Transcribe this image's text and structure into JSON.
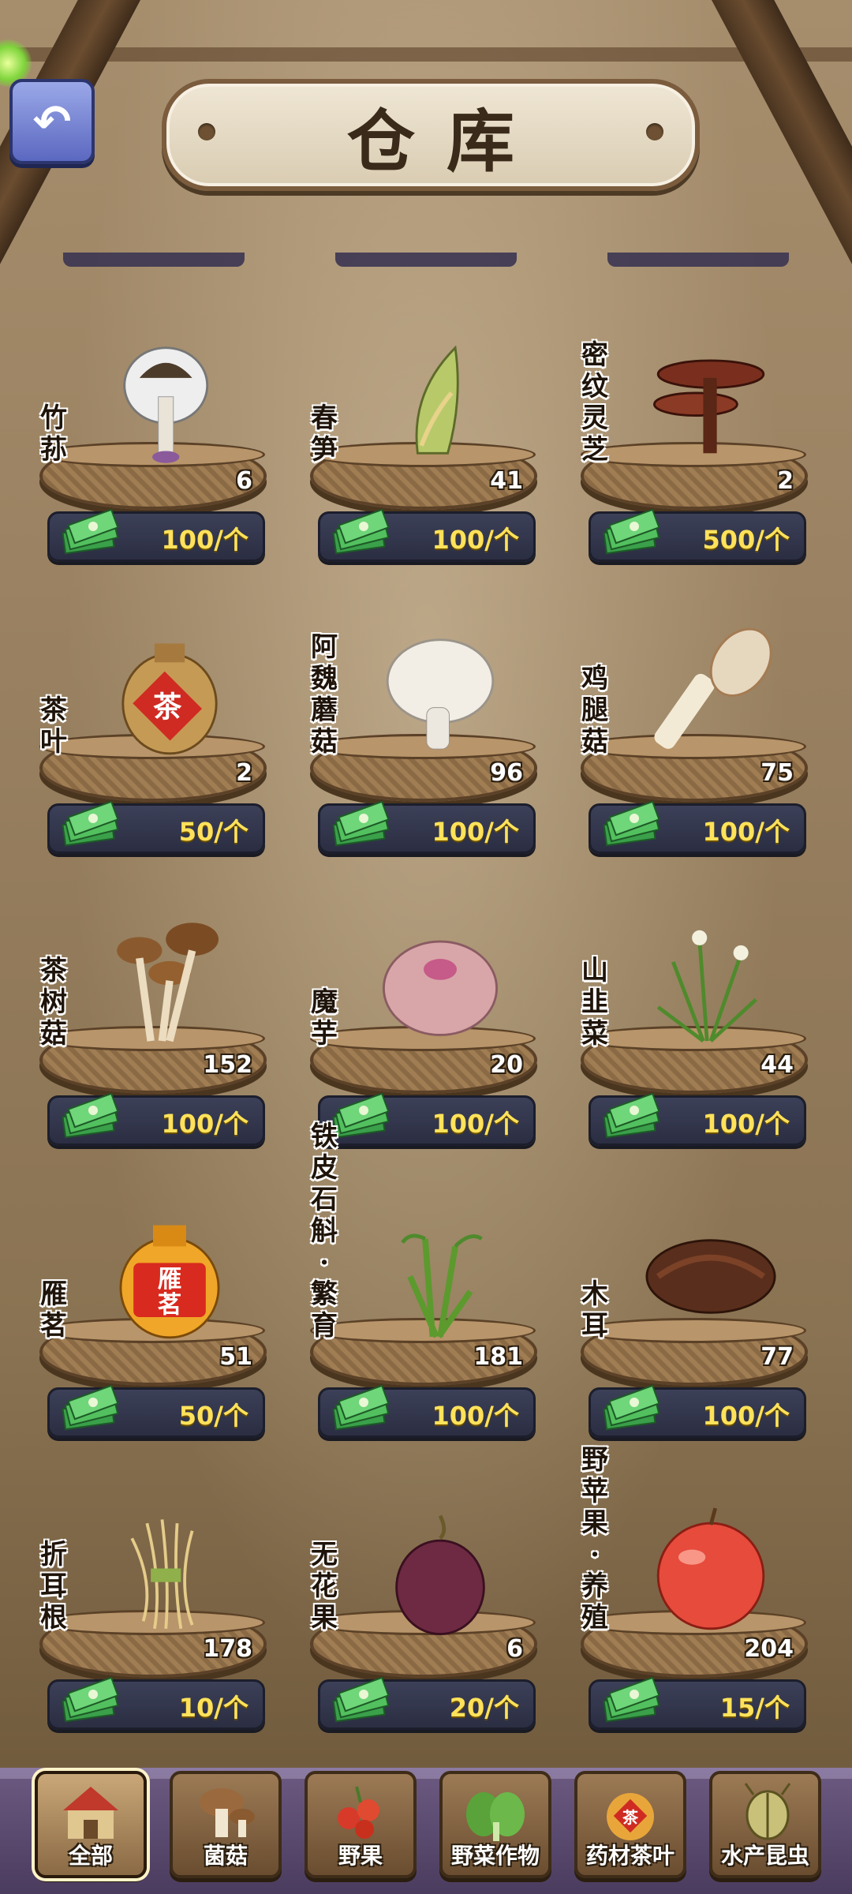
{
  "header": {
    "title": "仓库"
  },
  "colors": {
    "price_text": "#ffe25a",
    "tab_bar": "#4a3c5e",
    "back_button": "#5b68c0"
  },
  "items": [
    {
      "name": "竹荪",
      "count": "6",
      "price": "100/个",
      "icon": "bamboo-fungus-icon"
    },
    {
      "name": "春笋",
      "count": "41",
      "price": "100/个",
      "icon": "bamboo-shoot-icon"
    },
    {
      "name": "密纹灵芝",
      "count": "2",
      "price": "500/个",
      "icon": "lingzhi-icon"
    },
    {
      "name": "茶叶",
      "count": "2",
      "price": "50/个",
      "icon": "tea-jar-icon"
    },
    {
      "name": "阿魏蘑菇",
      "count": "96",
      "price": "100/个",
      "icon": "white-mushroom-icon"
    },
    {
      "name": "鸡腿菇",
      "count": "75",
      "price": "100/个",
      "icon": "shaggy-mane-icon"
    },
    {
      "name": "茶树菇",
      "count": "152",
      "price": "100/个",
      "icon": "tea-tree-mushroom-icon"
    },
    {
      "name": "魔芋",
      "count": "20",
      "price": "100/个",
      "icon": "konjac-icon"
    },
    {
      "name": "山韭菜",
      "count": "44",
      "price": "100/个",
      "icon": "wild-chive-icon"
    },
    {
      "name": "雁茗",
      "count": "51",
      "price": "50/个",
      "icon": "yanming-tea-jar-icon"
    },
    {
      "name": "铁皮石斛·繁育",
      "count": "181",
      "price": "100/个",
      "icon": "dendrobium-icon"
    },
    {
      "name": "木耳",
      "count": "77",
      "price": "100/个",
      "icon": "wood-ear-icon"
    },
    {
      "name": "折耳根",
      "count": "178",
      "price": "10/个",
      "icon": "houttuynia-root-icon"
    },
    {
      "name": "无花果",
      "count": "6",
      "price": "20/个",
      "icon": "fig-icon"
    },
    {
      "name": "野苹果·养殖",
      "count": "204",
      "price": "15/个",
      "icon": "apple-icon"
    }
  ],
  "tabs": [
    {
      "label": "全部",
      "icon": "barn-icon",
      "active": true
    },
    {
      "label": "菌菇",
      "icon": "mushroom-icon"
    },
    {
      "label": "野果",
      "icon": "berries-icon"
    },
    {
      "label": "野菜作物",
      "icon": "greens-icon"
    },
    {
      "label": "药材茶叶",
      "icon": "tea-jar-icon"
    },
    {
      "label": "水产昆虫",
      "icon": "beetle-icon"
    }
  ]
}
